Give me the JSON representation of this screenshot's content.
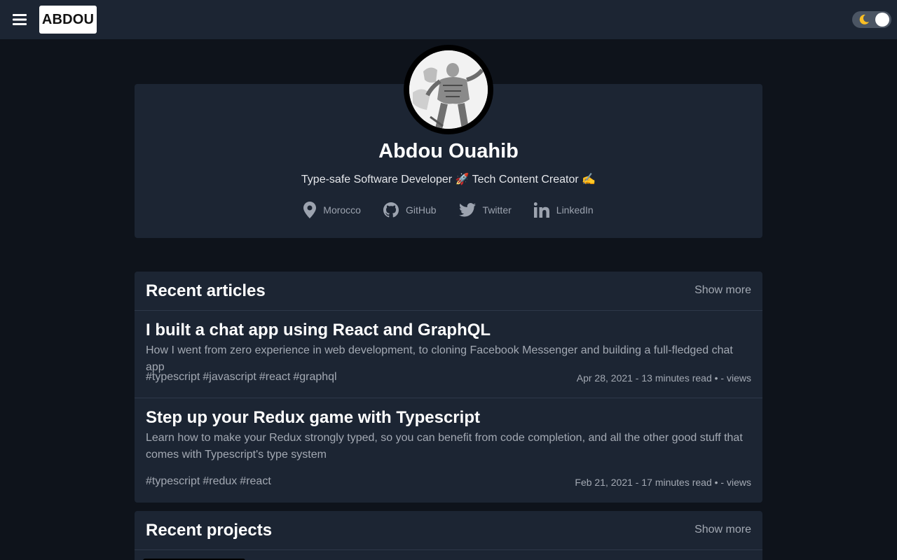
{
  "header": {
    "logo": "ABDOU"
  },
  "profile": {
    "name": "Abdou Ouahib",
    "bio": "Type-safe Software Developer 🚀 Tech Content Creator ✍️",
    "links": [
      {
        "label": "Morocco",
        "icon": "location-pin-icon"
      },
      {
        "label": "GitHub",
        "icon": "github-icon"
      },
      {
        "label": "Twitter",
        "icon": "twitter-icon"
      },
      {
        "label": "LinkedIn",
        "icon": "linkedin-icon"
      }
    ]
  },
  "articles": {
    "title": "Recent articles",
    "show_more": "Show more",
    "items": [
      {
        "title": "I built a chat app using React and GraphQL",
        "description": "How I went from zero experience in web development, to cloning Facebook Messenger and building a full-fledged chat app",
        "tags": [
          "#typescript",
          "#javascript",
          "#react",
          "#graphql"
        ],
        "meta": "Apr 28, 2021 - 13 minutes read • - views"
      },
      {
        "title": "Step up your Redux game with Typescript",
        "description": "Learn how to make your Redux strongly typed, so you can benefit from code completion, and all the other good stuff that comes with Typescript's type system",
        "tags": [
          "#typescript",
          "#redux",
          "#react"
        ],
        "meta": "Feb 21, 2021 - 17 minutes read • - views"
      }
    ]
  },
  "projects": {
    "title": "Recent projects",
    "show_more": "Show more"
  },
  "colors": {
    "page_bg": "#0e131b",
    "card_bg": "#1c2533",
    "text_muted": "#a3a9b3"
  }
}
